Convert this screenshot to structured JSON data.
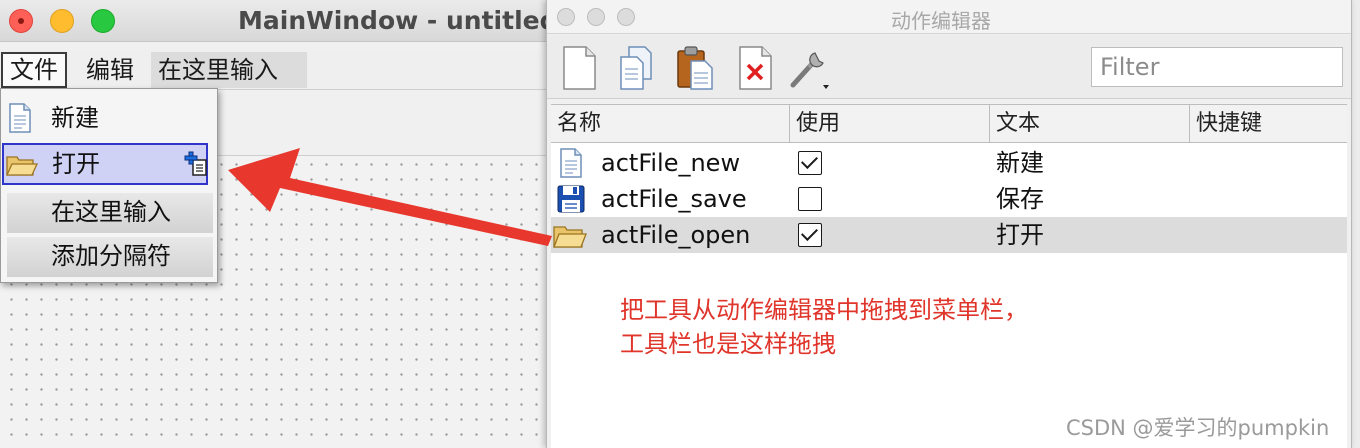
{
  "main_window": {
    "title": "MainWindow - untitled",
    "menubar": {
      "file": "文件",
      "edit": "编辑",
      "type_here": "在这里输入"
    },
    "file_menu": {
      "items": [
        {
          "label": "新建",
          "icon": "new-document-icon"
        },
        {
          "label": "打开",
          "icon": "folder-open-icon",
          "highlighted": true
        },
        {
          "label": "在这里输入"
        },
        {
          "label": "添加分隔符"
        }
      ]
    }
  },
  "action_editor": {
    "title": "动作编辑器",
    "toolbar": [
      "new-action-icon",
      "copy-icon",
      "paste-icon",
      "delete-icon",
      "configure-icon"
    ],
    "filter": {
      "placeholder": "Filter",
      "value": ""
    },
    "table": {
      "headers": [
        "名称",
        "使用",
        "文本",
        "快捷键"
      ],
      "rows": [
        {
          "name": "actFile_new",
          "used": true,
          "text": "新建",
          "shortcut": "",
          "icon": "new-document-icon"
        },
        {
          "name": "actFile_save",
          "used": false,
          "text": "保存",
          "shortcut": "",
          "icon": "floppy-disk-icon"
        },
        {
          "name": "actFile_open",
          "used": true,
          "text": "打开",
          "shortcut": "",
          "icon": "folder-open-icon",
          "selected": true
        }
      ]
    }
  },
  "annotation": {
    "line1": "把工具从动作编辑器中拖拽到菜单栏，",
    "line2": "工具栏也是这样拖拽",
    "color": "#e0352b"
  },
  "watermark": "CSDN @爱学习的pumpkin"
}
